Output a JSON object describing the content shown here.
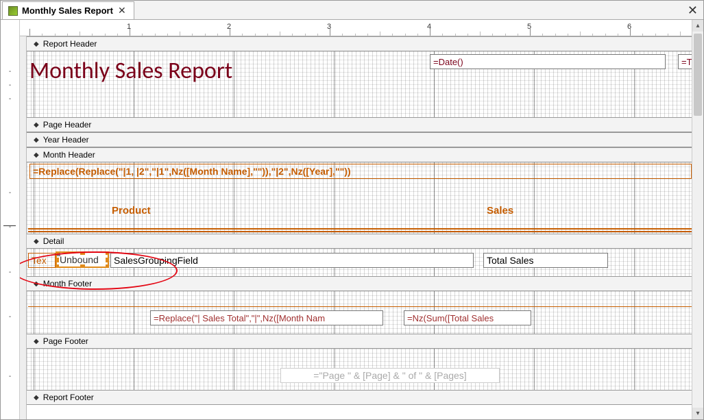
{
  "tab": {
    "title": "Monthly Sales Report"
  },
  "ruler_numbers": [
    "1",
    "2",
    "3",
    "4",
    "5",
    "6"
  ],
  "sections": {
    "report_header": "Report Header",
    "page_header": "Page Header",
    "year_header": "Year Header",
    "month_header": "Month Header",
    "detail": "Detail",
    "month_footer": "Month Footer",
    "page_footer": "Page Footer",
    "report_footer": "Report Footer"
  },
  "report_header": {
    "title": "Monthly Sales Report",
    "date_expr": "=Date()",
    "time_expr_partial": "=T"
  },
  "month_header": {
    "group_expr": "=Replace(Replace(\"|1, |2\",\"|1\",Nz([Month Name],\"\")),\"|2\",Nz([Year],\"\"))",
    "col_product": "Product",
    "col_sales": "Sales"
  },
  "detail": {
    "label_prefix": "Tex",
    "unbound": "Unbound",
    "grouping_field": "SalesGroupingField",
    "total_sales": "Total Sales"
  },
  "month_footer": {
    "sales_total_expr": "=Replace(\"| Sales Total\",\"|\",Nz([Month Nam",
    "sum_expr": "=Nz(Sum([Total Sales"
  },
  "page_footer": {
    "page_expr": "=\"Page \" & [Page] & \" of \" & [Pages]"
  }
}
